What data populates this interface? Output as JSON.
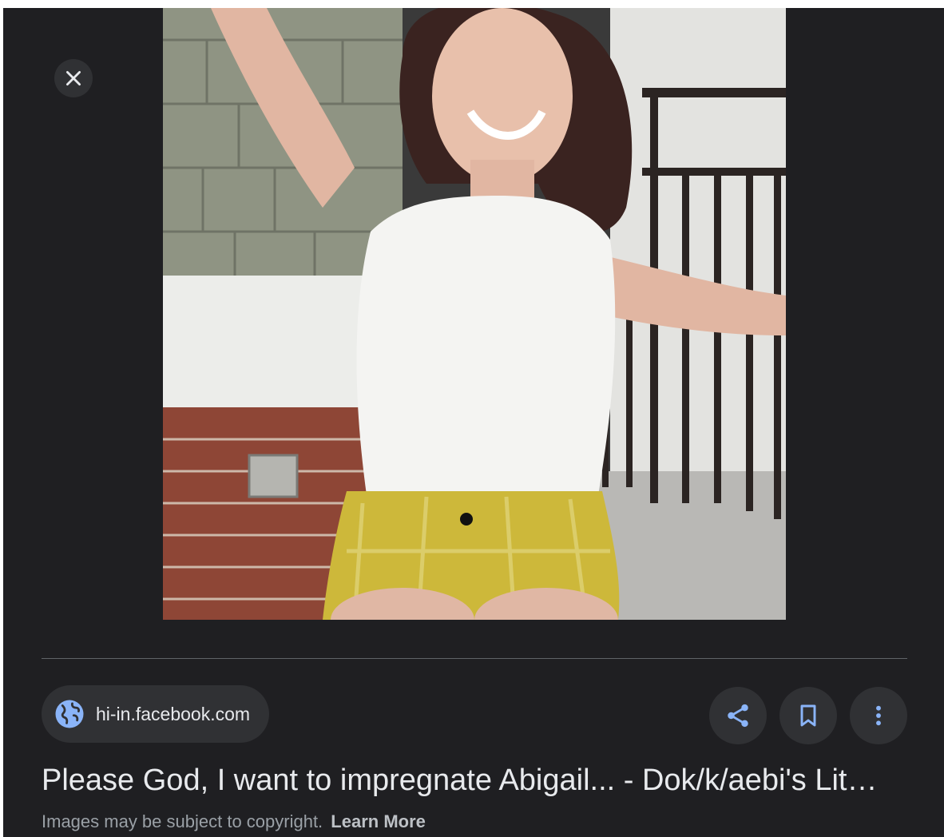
{
  "viewer": {
    "close_icon": "close-icon",
    "image_alt": "Photo of a smiling woman in a white tank top and yellow shorts sitting on a porch",
    "source": {
      "icon": "globe-icon",
      "domain": "hi-in.facebook.com"
    },
    "actions": [
      {
        "name": "share",
        "icon": "share-icon"
      },
      {
        "name": "save",
        "icon": "bookmark-icon"
      },
      {
        "name": "more",
        "icon": "more-vert-icon"
      }
    ],
    "title": "Please God, I want to impregnate Abigail... - Dok/k/aebi's Lit…",
    "copyright_text": "Images may be subject to copyright.",
    "learn_more": "Learn More"
  },
  "colors": {
    "background": "#1f1f22",
    "chip": "#303134",
    "accent_blue": "#8ab4f8",
    "text": "#e8eaed",
    "muted": "#9aa0a6"
  }
}
